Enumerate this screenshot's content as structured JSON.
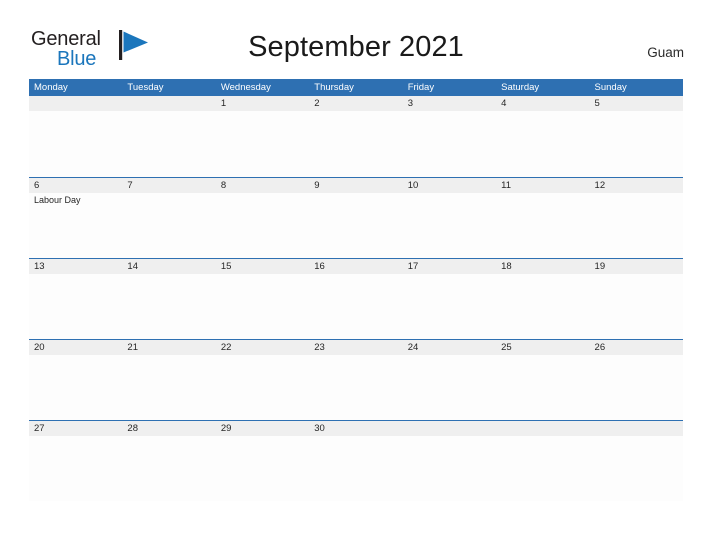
{
  "brand": {
    "name_part1": "General",
    "name_part2": "Blue",
    "logo_icon": "flag-triangle-icon",
    "color_primary": "#1b76bc",
    "color_dark": "#231f20"
  },
  "header": {
    "title": "September 2021",
    "region": "Guam"
  },
  "theme": {
    "header_blue": "#2e70b2",
    "date_band_gray": "#efefef",
    "text_dark": "#262626",
    "page_background": "#ffffff"
  },
  "calendar": {
    "month": "September",
    "year": "2021",
    "weekday_headers": [
      "Monday",
      "Tuesday",
      "Wednesday",
      "Thursday",
      "Friday",
      "Saturday",
      "Sunday"
    ],
    "weeks": [
      {
        "days": [
          {
            "number": "",
            "events": []
          },
          {
            "number": "",
            "events": []
          },
          {
            "number": "1",
            "events": []
          },
          {
            "number": "2",
            "events": []
          },
          {
            "number": "3",
            "events": []
          },
          {
            "number": "4",
            "events": []
          },
          {
            "number": "5",
            "events": []
          }
        ]
      },
      {
        "days": [
          {
            "number": "6",
            "events": [
              "Labour Day"
            ]
          },
          {
            "number": "7",
            "events": []
          },
          {
            "number": "8",
            "events": []
          },
          {
            "number": "9",
            "events": []
          },
          {
            "number": "10",
            "events": []
          },
          {
            "number": "11",
            "events": []
          },
          {
            "number": "12",
            "events": []
          }
        ]
      },
      {
        "days": [
          {
            "number": "13",
            "events": []
          },
          {
            "number": "14",
            "events": []
          },
          {
            "number": "15",
            "events": []
          },
          {
            "number": "16",
            "events": []
          },
          {
            "number": "17",
            "events": []
          },
          {
            "number": "18",
            "events": []
          },
          {
            "number": "19",
            "events": []
          }
        ]
      },
      {
        "days": [
          {
            "number": "20",
            "events": []
          },
          {
            "number": "21",
            "events": []
          },
          {
            "number": "22",
            "events": []
          },
          {
            "number": "23",
            "events": []
          },
          {
            "number": "24",
            "events": []
          },
          {
            "number": "25",
            "events": []
          },
          {
            "number": "26",
            "events": []
          }
        ]
      },
      {
        "days": [
          {
            "number": "27",
            "events": []
          },
          {
            "number": "28",
            "events": []
          },
          {
            "number": "29",
            "events": []
          },
          {
            "number": "30",
            "events": []
          },
          {
            "number": "",
            "events": []
          },
          {
            "number": "",
            "events": []
          },
          {
            "number": "",
            "events": []
          }
        ]
      }
    ]
  }
}
